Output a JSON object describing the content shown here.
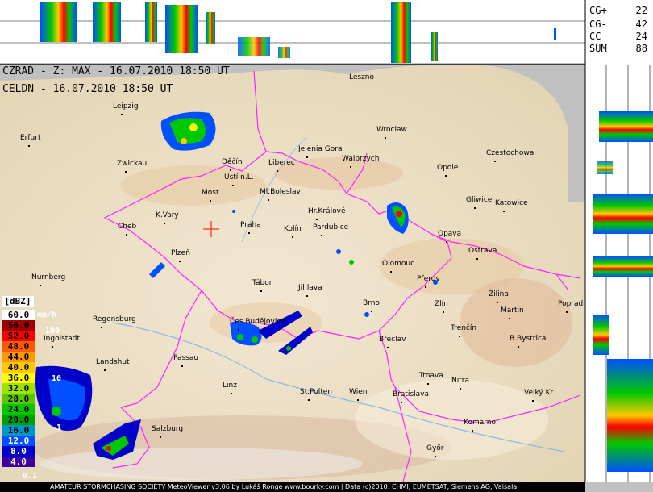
{
  "header": {
    "line1": "CZRAD - Z: MAX - 16.07.2010 18:50 UT",
    "line2": "CELDN - 16.07.2010 18:50 UT"
  },
  "lightning": {
    "rows": [
      {
        "label": "CG+",
        "value": "22"
      },
      {
        "label": "CG-",
        "value": "42"
      },
      {
        "label": "CC",
        "value": "24"
      },
      {
        "label": "SUM",
        "value": "88"
      }
    ]
  },
  "legend": {
    "unit": "[dBZ]",
    "rain_unit": "mm/h",
    "rows": [
      {
        "value": "60.0",
        "color": "#ffffff",
        "text_color": "#000000"
      },
      {
        "value": "56.0",
        "color": "#a00000",
        "text_color": "#000000"
      },
      {
        "value": "52.0",
        "color": "#fe0000",
        "text_color": "#000000"
      },
      {
        "value": "48.0",
        "color": "#fe5a00",
        "text_color": "#000000"
      },
      {
        "value": "44.0",
        "color": "#fe9a00",
        "text_color": "#000000"
      },
      {
        "value": "40.0",
        "color": "#fec800",
        "text_color": "#000000"
      },
      {
        "value": "36.0",
        "color": "#fefe00",
        "text_color": "#000000"
      },
      {
        "value": "32.0",
        "color": "#9ce400",
        "text_color": "#000000"
      },
      {
        "value": "28.0",
        "color": "#58c800",
        "text_color": "#000000"
      },
      {
        "value": "24.0",
        "color": "#00c800",
        "text_color": "#000000"
      },
      {
        "value": "20.0",
        "color": "#00a000",
        "text_color": "#000000"
      },
      {
        "value": "16.0",
        "color": "#0096c8",
        "text_color": "#000000"
      },
      {
        "value": "12.0",
        "color": "#0050ff",
        "text_color": "#ffffff"
      },
      {
        "value": "8.0",
        "color": "#0000c8",
        "text_color": "#ffffff"
      },
      {
        "value": "4.0",
        "color": "#3c00a0",
        "text_color": "#ffffff"
      }
    ],
    "rain_labels": [
      "100",
      "10",
      "1",
      "0.1"
    ]
  },
  "cities": [
    {
      "name": "Leszno",
      "dot": false
    },
    {
      "name": "Leipzig",
      "dot": true
    },
    {
      "name": "Wroclaw",
      "dot": true
    },
    {
      "name": "Jelenia Gora",
      "dot": true
    },
    {
      "name": "Walbrzych",
      "dot": true
    },
    {
      "name": "Czestochowa",
      "dot": true
    },
    {
      "name": "Erfurt",
      "dot": true
    },
    {
      "name": "Zwickau",
      "dot": true
    },
    {
      "name": "Děčín",
      "dot": true
    },
    {
      "name": "Liberec",
      "dot": true
    },
    {
      "name": "Opole",
      "dot": true
    },
    {
      "name": "Ústí n.L.",
      "dot": true
    },
    {
      "name": "Most",
      "dot": true
    },
    {
      "name": "Ml.Boleslav",
      "dot": true
    },
    {
      "name": "Gliwice",
      "dot": true
    },
    {
      "name": "Katowice",
      "dot": true
    },
    {
      "name": "K.Vary",
      "dot": true
    },
    {
      "name": "Hr.Králové",
      "dot": true
    },
    {
      "name": "Cheb",
      "dot": true
    },
    {
      "name": "Praha",
      "dot": true
    },
    {
      "name": "Kolín",
      "dot": true
    },
    {
      "name": "Pardubice",
      "dot": true
    },
    {
      "name": "Opava",
      "dot": true
    },
    {
      "name": "Plzeň",
      "dot": true
    },
    {
      "name": "Olomouc",
      "dot": true
    },
    {
      "name": "Ostrava",
      "dot": true
    },
    {
      "name": "Přerov",
      "dot": true
    },
    {
      "name": "Nurnberg",
      "dot": true
    },
    {
      "name": "Tábor",
      "dot": true
    },
    {
      "name": "Jihlava",
      "dot": true
    },
    {
      "name": "Brno",
      "dot": true
    },
    {
      "name": "Zlín",
      "dot": true
    },
    {
      "name": "Žilina",
      "dot": true
    },
    {
      "name": "Martin",
      "dot": true
    },
    {
      "name": "Poprad",
      "dot": true
    },
    {
      "name": "Regensburg",
      "dot": true
    },
    {
      "name": "Čes.Budějovice",
      "dot": true
    },
    {
      "name": "Trenčín",
      "dot": true
    },
    {
      "name": "Ingolstadt",
      "dot": true
    },
    {
      "name": "Břeclav",
      "dot": true
    },
    {
      "name": "B.Bystrica",
      "dot": true
    },
    {
      "name": "Passau",
      "dot": true
    },
    {
      "name": "Landshut",
      "dot": true
    },
    {
      "name": "Trnava",
      "dot": true
    },
    {
      "name": "Linz",
      "dot": true
    },
    {
      "name": "St.Polten",
      "dot": true
    },
    {
      "name": "Wien",
      "dot": true
    },
    {
      "name": "Nitra",
      "dot": true
    },
    {
      "name": "Bratislava",
      "dot": true
    },
    {
      "name": "Velký Kr",
      "dot": true
    },
    {
      "name": "Salzburg",
      "dot": true
    },
    {
      "name": "Komarno",
      "dot": true
    },
    {
      "name": "Győr",
      "dot": true
    }
  ],
  "footer": {
    "text": "AMATEUR STORMCHASING SOCIETY MeteoViewer v3.06 by Lukáš Ronge www.bourky.com | Data (c)2010: CHMI, EUMETSAT, Siemens AG, Vaisala"
  },
  "colors": {
    "border": "#ff22ff",
    "radar_marker": "#ff0000",
    "outside": "#c0c0c0"
  }
}
